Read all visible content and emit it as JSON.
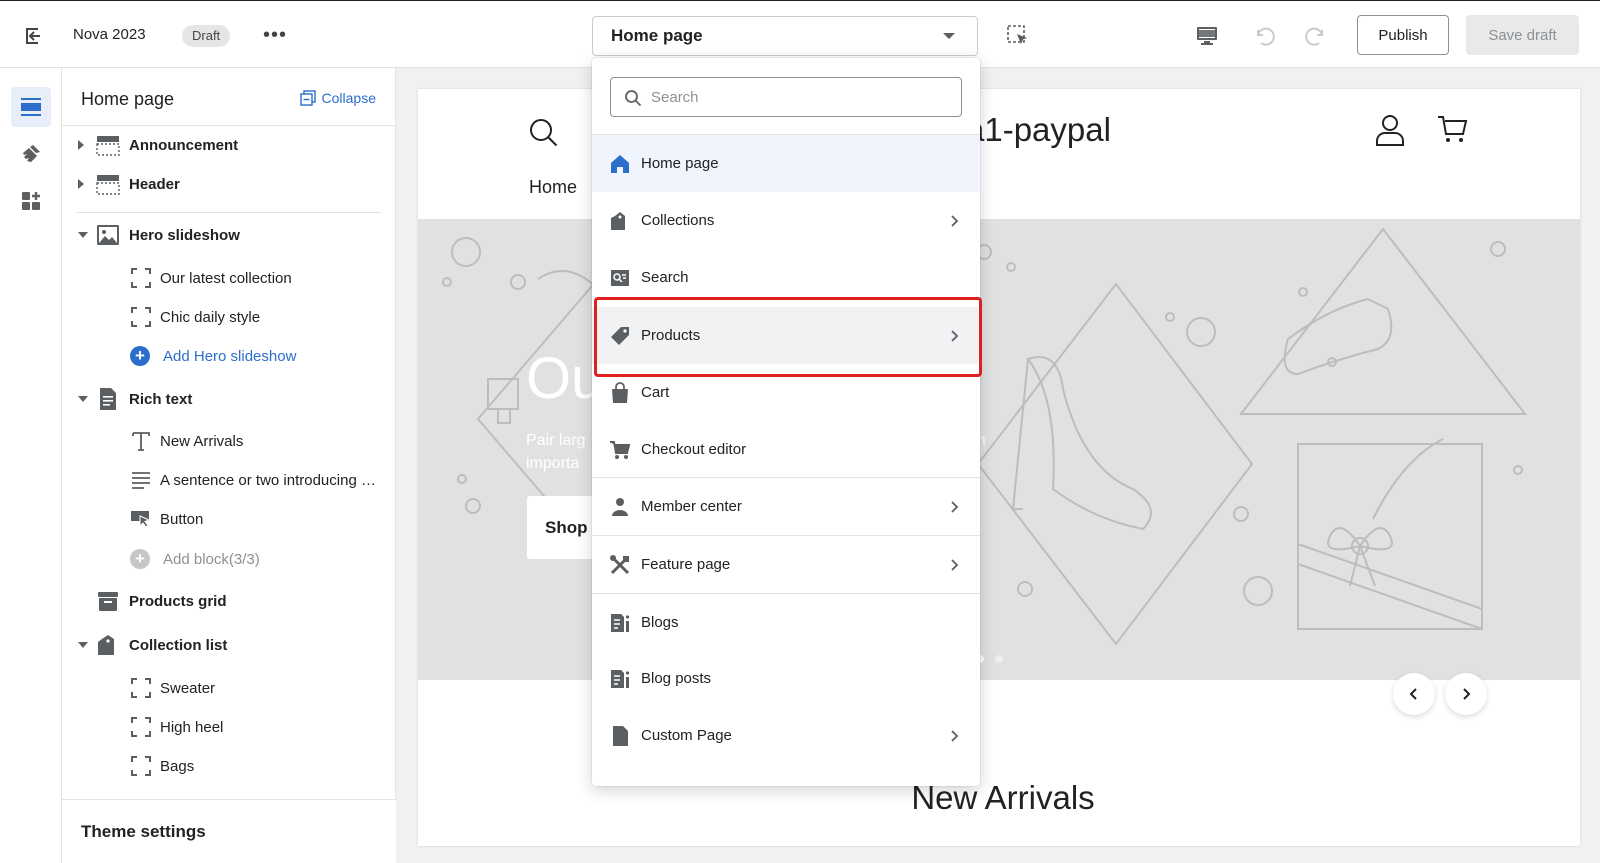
{
  "topbar": {
    "theme_name": "Nova 2023",
    "status_badge": "Draft",
    "more_label": "•••",
    "page_select_value": "Home page",
    "publish_label": "Publish",
    "save_label": "Save draft"
  },
  "sidebar": {
    "title": "Home page",
    "collapse_label": "Collapse",
    "sections": {
      "announcement": "Announcement",
      "header": "Header",
      "hero_slideshow": "Hero slideshow",
      "hero_block_1": "Our latest collection",
      "hero_block_2": "Chic daily style",
      "hero_add": "Add Hero slideshow",
      "rich_text": "Rich text",
      "rich_block_1": "New Arrivals",
      "rich_block_2": "A sentence or two introducing your collection",
      "rich_block_3": "Button",
      "rich_add": "Add block(3/3)",
      "products_grid": "Products grid",
      "collection_list": "Collection list",
      "col_block_1": "Sweater",
      "col_block_2": "High heel",
      "col_block_3": "Bags"
    },
    "theme_settings": "Theme settings"
  },
  "preview": {
    "store_name": "a1-paypal",
    "nav_home": "Home",
    "hero_title": "Ou                        ion",
    "hero_sub_1": "Pair larg",
    "hero_sub_2": "importa",
    "hero_sub_right": "an",
    "hero_button": "Shop n",
    "section_heading": "New Arrivals"
  },
  "dropdown": {
    "search_placeholder": "Search",
    "items": [
      {
        "label": "Home page",
        "icon": "home-icon"
      },
      {
        "label": "Collections",
        "icon": "collections-icon"
      },
      {
        "label": "Search",
        "icon": "search-page-icon"
      },
      {
        "label": "Products",
        "icon": "tag-icon"
      },
      {
        "label": "Cart",
        "icon": "bag-icon"
      },
      {
        "label": "Checkout editor",
        "icon": "cart-icon"
      },
      {
        "label": "Member center",
        "icon": "person-icon"
      },
      {
        "label": "Feature page",
        "icon": "tools-icon"
      },
      {
        "label": "Blogs",
        "icon": "blog-icon"
      },
      {
        "label": "Blog posts",
        "icon": "blog-post-icon"
      },
      {
        "label": "Custom Page",
        "icon": "page-icon"
      }
    ]
  },
  "colors": {
    "accent": "#2c6ecb",
    "highlight": "#e02020",
    "selected_bg": "#f0f5fd"
  }
}
